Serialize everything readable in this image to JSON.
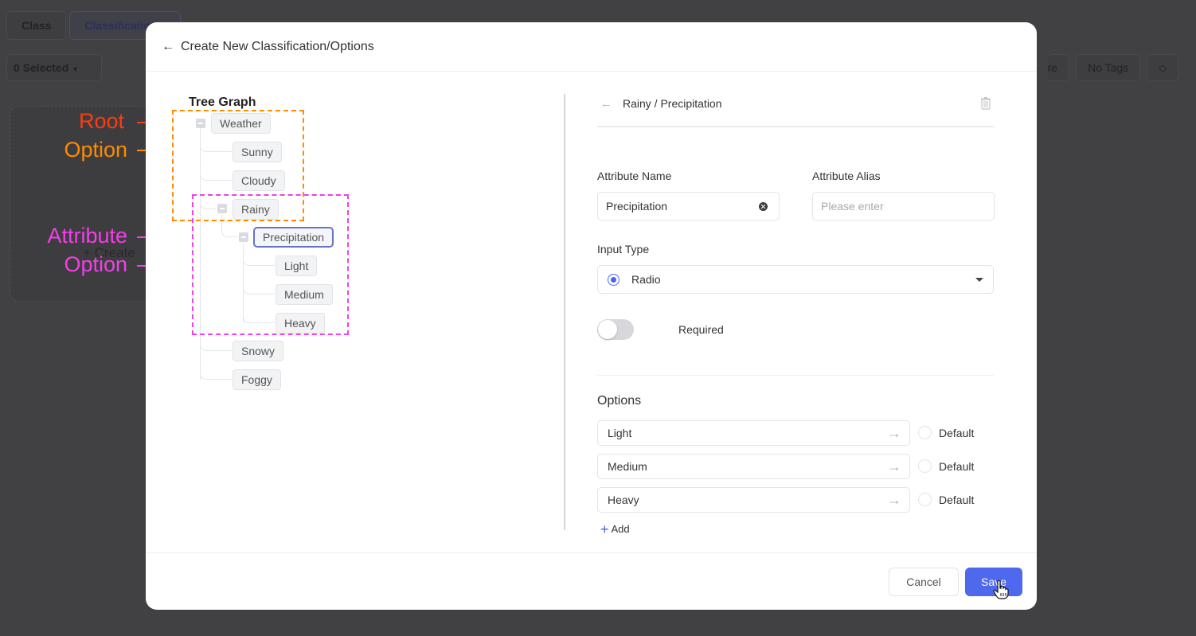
{
  "background": {
    "tabs": [
      "Class",
      "Classification"
    ],
    "selected_dropdown": "0 Selected",
    "right_chips": [
      "re",
      "No Tags"
    ],
    "tag_icon": "tag-icon",
    "create_label": "+ Create"
  },
  "annotations": [
    {
      "label": "Root",
      "color": "#ff3b12"
    },
    {
      "label": "Option",
      "color": "#ff8c00"
    },
    {
      "label": "Attribute",
      "color": "#f23fe6"
    },
    {
      "label": "Option",
      "color": "#f23fe6"
    }
  ],
  "modal": {
    "title": "Create New Classification/Options",
    "back_icon": "arrow-left-icon",
    "tree": {
      "title": "Tree Graph",
      "nodes": [
        {
          "label": "Weather",
          "type": "root"
        },
        {
          "label": "Sunny",
          "type": "option"
        },
        {
          "label": "Cloudy",
          "type": "option"
        },
        {
          "label": "Rainy",
          "type": "option"
        },
        {
          "label": "Precipitation",
          "type": "attribute",
          "selected": true
        },
        {
          "label": "Light",
          "type": "option"
        },
        {
          "label": "Medium",
          "type": "option"
        },
        {
          "label": "Heavy",
          "type": "option"
        },
        {
          "label": "Snowy",
          "type": "option"
        },
        {
          "label": "Foggy",
          "type": "option"
        }
      ]
    },
    "detail": {
      "breadcrumb": "Rainy / Precipitation",
      "attribute_name": {
        "label": "Attribute Name",
        "value": "Precipitation"
      },
      "attribute_alias": {
        "label": "Attribute Alias",
        "placeholder": "Please enter"
      },
      "input_type": {
        "label": "Input Type",
        "value": "Radio"
      },
      "required": {
        "label": "Required",
        "on": false
      },
      "options": {
        "title": "Options",
        "items": [
          {
            "value": "Light",
            "default_label": "Default",
            "is_default": false
          },
          {
            "value": "Medium",
            "default_label": "Default",
            "is_default": false
          },
          {
            "value": "Heavy",
            "default_label": "Default",
            "is_default": false
          }
        ],
        "add_label": "Add"
      }
    },
    "footer": {
      "cancel_label": "Cancel",
      "save_label": "Save"
    }
  },
  "colors": {
    "accent": "#4e68ee",
    "root_annotation": "#ff3b12",
    "option_annotation": "#ff8c00",
    "attribute_annotation": "#f23fe6"
  }
}
